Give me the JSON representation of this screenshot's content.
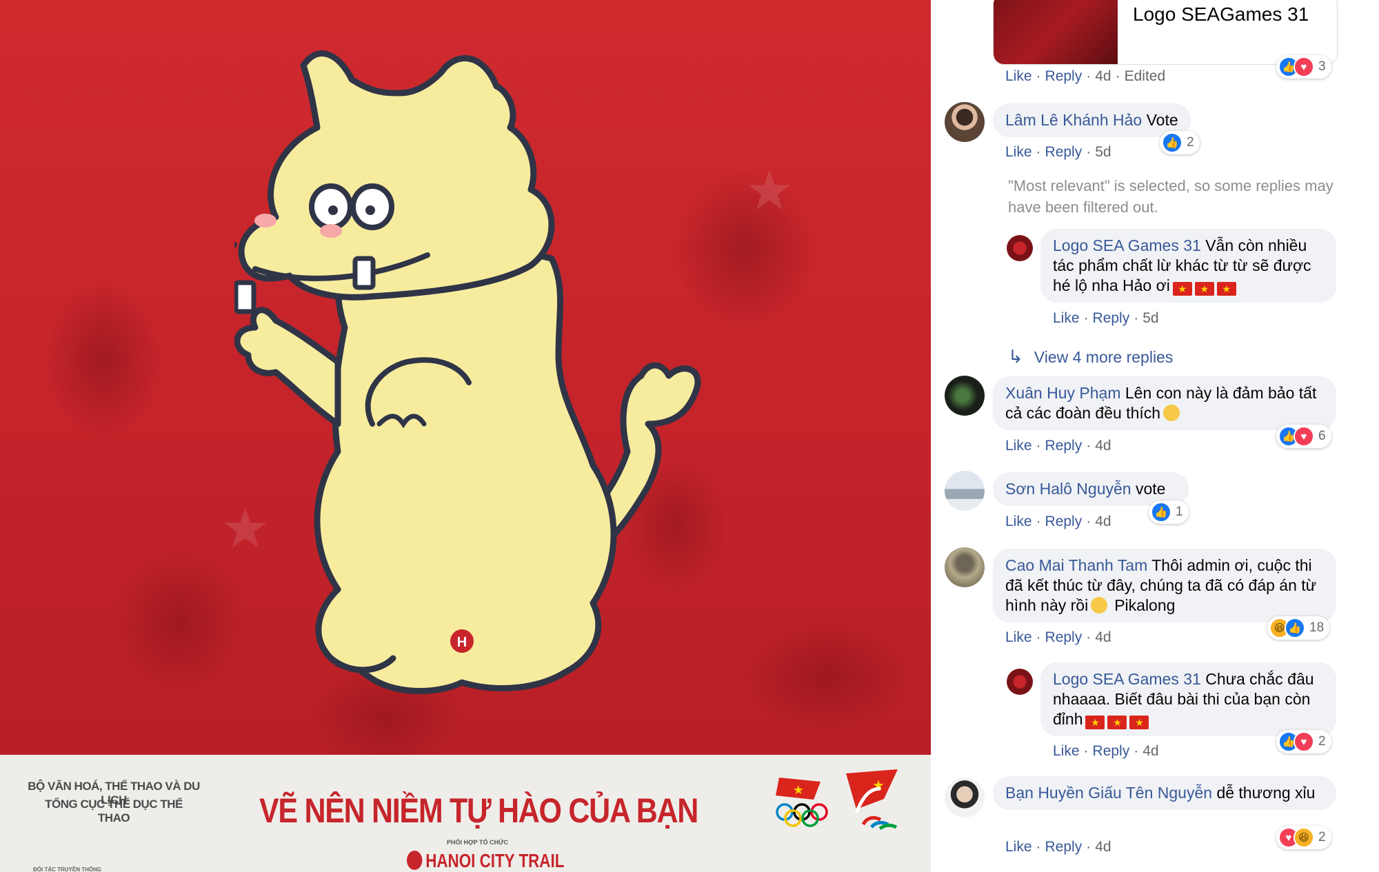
{
  "poster": {
    "ministry_line1": "BỘ VĂN HOÁ, THỂ THAO  VÀ DU LỊCH",
    "ministry_line2": "TỔNG CỤC THỂ DỤC THỂ THAO",
    "title": "VẼ NÊN NIỀM TỰ HÀO CỦA BẠN",
    "organizer_label": "PHỐI HỢP TỔ CHỨC",
    "brand": "HANOI CITY TRAIL",
    "partner_label": "ĐỐI TÁC TRUYỀN THÔNG"
  },
  "top_card": {
    "label": "Logo SEAGames 31",
    "actions": {
      "like": "Like",
      "reply": "Reply",
      "time": "4d",
      "edited": "Edited"
    },
    "reactions": {
      "types": [
        "like",
        "love"
      ],
      "count": "3"
    }
  },
  "comments": [
    {
      "author": "Lâm Lê Khánh Hảo",
      "text": "Vote",
      "avatar": "user-avatar",
      "actions": {
        "like": "Like",
        "reply": "Reply",
        "time": "5d"
      },
      "reactions": {
        "types": [
          "like"
        ],
        "count": "2"
      }
    },
    {
      "author": "Logo SEA Games 31",
      "text": "Vẫn còn nhiều tác phẩm chất lừ khác từ từ sẽ được hé lộ nha Hảo ơi",
      "avatar": "page-avatar",
      "actions": {
        "like": "Like",
        "reply": "Reply",
        "time": "5d"
      }
    },
    {
      "author": "Xuân Huy Phạm",
      "text": "Lên con này là đảm bảo tất cả các đoàn đều thích",
      "avatar": "user-avatar",
      "actions": {
        "like": "Like",
        "reply": "Reply",
        "time": "4d"
      },
      "reactions": {
        "types": [
          "like",
          "love"
        ],
        "count": "6"
      }
    },
    {
      "author": "Sơn Halô Nguyễn",
      "text": "vote",
      "avatar": "user-avatar",
      "actions": {
        "like": "Like",
        "reply": "Reply",
        "time": "4d"
      },
      "reactions": {
        "types": [
          "like"
        ],
        "count": "1"
      }
    },
    {
      "author": "Cao Mai Thanh Tam",
      "text": "Thôi admin ơi, cuộc thi đã kết thúc từ đây, chúng ta đã có đáp án từ hình này rồi",
      "text_tail": "Pikalong",
      "avatar": "user-avatar",
      "actions": {
        "like": "Like",
        "reply": "Reply",
        "time": "4d"
      },
      "reactions": {
        "types": [
          "haha",
          "like"
        ],
        "count": "18"
      }
    },
    {
      "author": "Logo SEA Games 31",
      "text": "Chưa chắc đâu nhaaaa. Biết đâu bài thi của bạn còn đỉnh",
      "avatar": "page-avatar",
      "actions": {
        "like": "Like",
        "reply": "Reply",
        "time": "4d"
      },
      "reactions": {
        "types": [
          "like",
          "love"
        ],
        "count": "2"
      }
    },
    {
      "author": "Bạn Huyền Giấu Tên Nguyễn",
      "text": "dễ thương xỉu",
      "avatar": "user-avatar",
      "actions": {
        "like": "Like",
        "reply": "Reply",
        "time": "4d"
      },
      "reactions": {
        "types": [
          "love",
          "haha"
        ],
        "count": "2"
      }
    }
  ],
  "filter_note": "\"Most relevant\" is selected, so some replies may have been filtered out.",
  "view_more": "View 4 more replies",
  "colors": {
    "accent_red": "#c7252b",
    "link_blue": "#385898",
    "bubble_gray": "#f0f2f5",
    "dragon_yellow": "#f7ec9e"
  }
}
